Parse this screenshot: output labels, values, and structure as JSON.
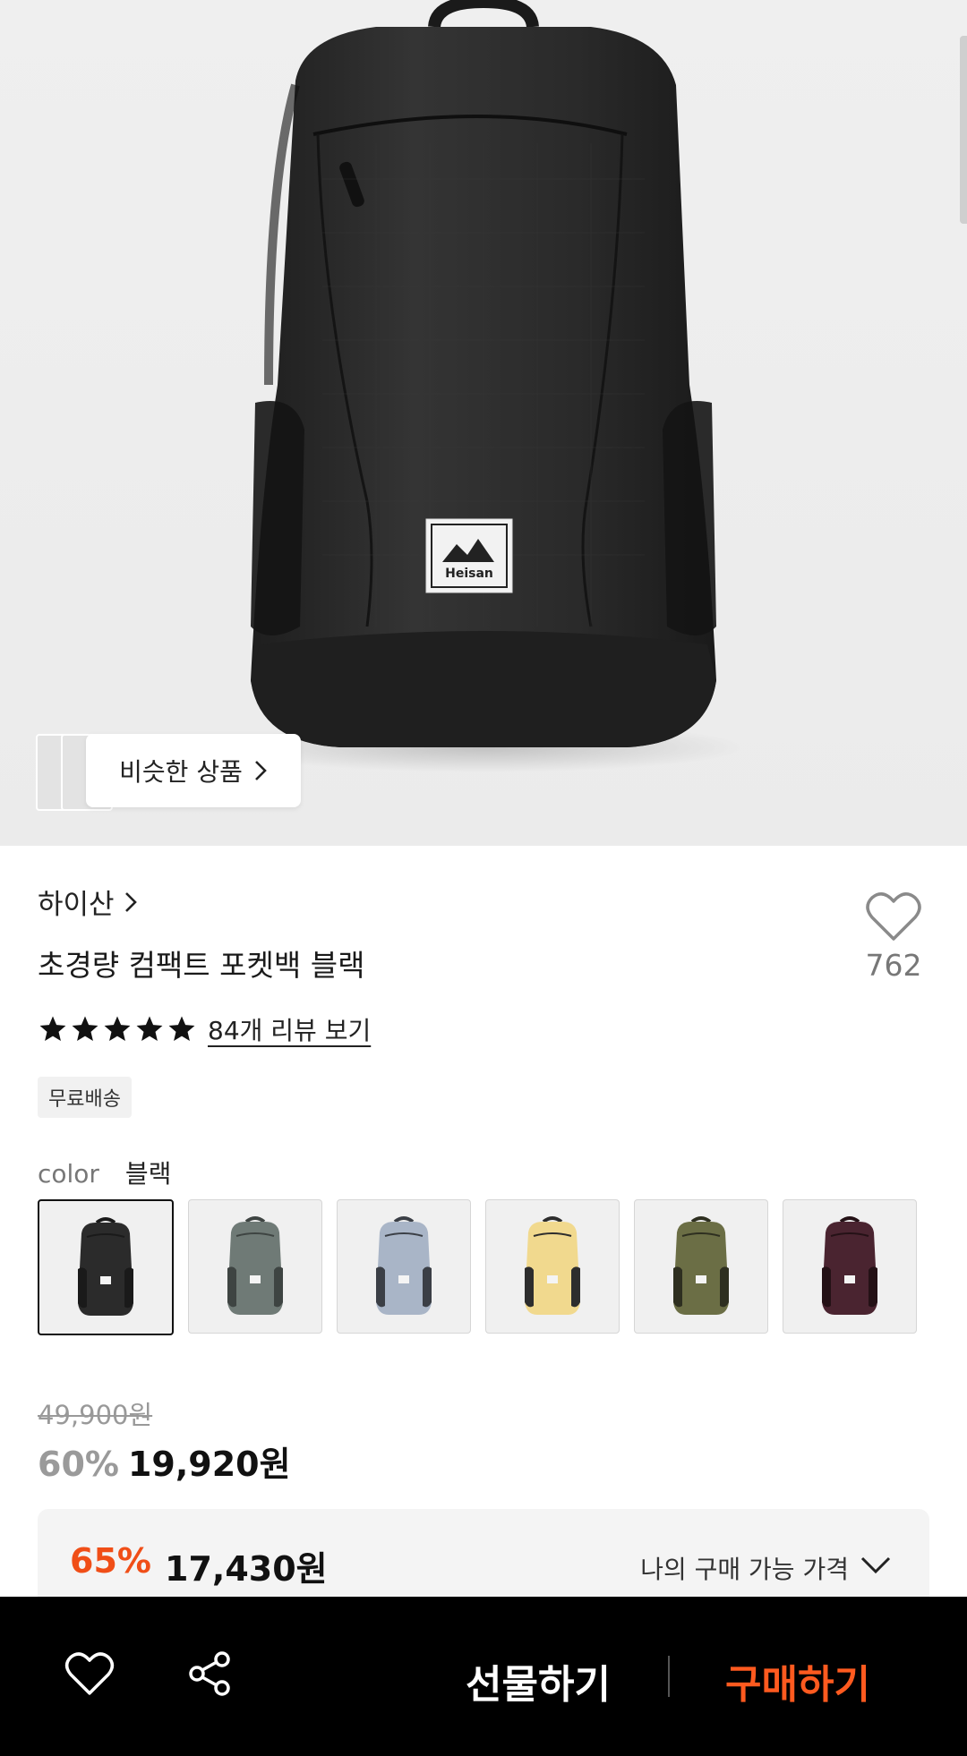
{
  "hero": {
    "product_image": "black-backpack-photo",
    "patch_text": "Heisan",
    "similar_label": "비슷한 상품"
  },
  "brand": {
    "name": "하이산"
  },
  "product": {
    "title": "초경량 컴팩트 포켓백 블랙"
  },
  "like": {
    "count": "762"
  },
  "rating": {
    "stars": 5,
    "review_link": "84개 리뷰 보기"
  },
  "badge": {
    "shipping": "무료배송"
  },
  "color": {
    "label": "color",
    "selected": "블랙",
    "options": [
      {
        "name": "black",
        "body": "#2b2b2b",
        "accent": "#1a1a1a"
      },
      {
        "name": "gray-green",
        "body": "#6f7a76",
        "accent": "#3e4442"
      },
      {
        "name": "light-blue",
        "body": "#a9b5c7",
        "accent": "#3b3f46"
      },
      {
        "name": "yellow",
        "body": "#f1d98e",
        "accent": "#2d2d2d"
      },
      {
        "name": "olive",
        "body": "#6b6e45",
        "accent": "#2e2f20"
      },
      {
        "name": "burgundy",
        "body": "#4a2430",
        "accent": "#241116"
      }
    ]
  },
  "price": {
    "original": "49,900원",
    "discount_pct": "60%",
    "sale": "19,920원"
  },
  "my_price": {
    "discount_pct": "65%",
    "amount": "17,430원",
    "label": "나의 구매 가능 가격"
  },
  "bottom_bar": {
    "gift_label": "선물하기",
    "buy_label": "구매하기"
  },
  "colors": {
    "accent": "#f04e17",
    "buy": "#ff5a1f",
    "bar_bg": "#000000"
  }
}
